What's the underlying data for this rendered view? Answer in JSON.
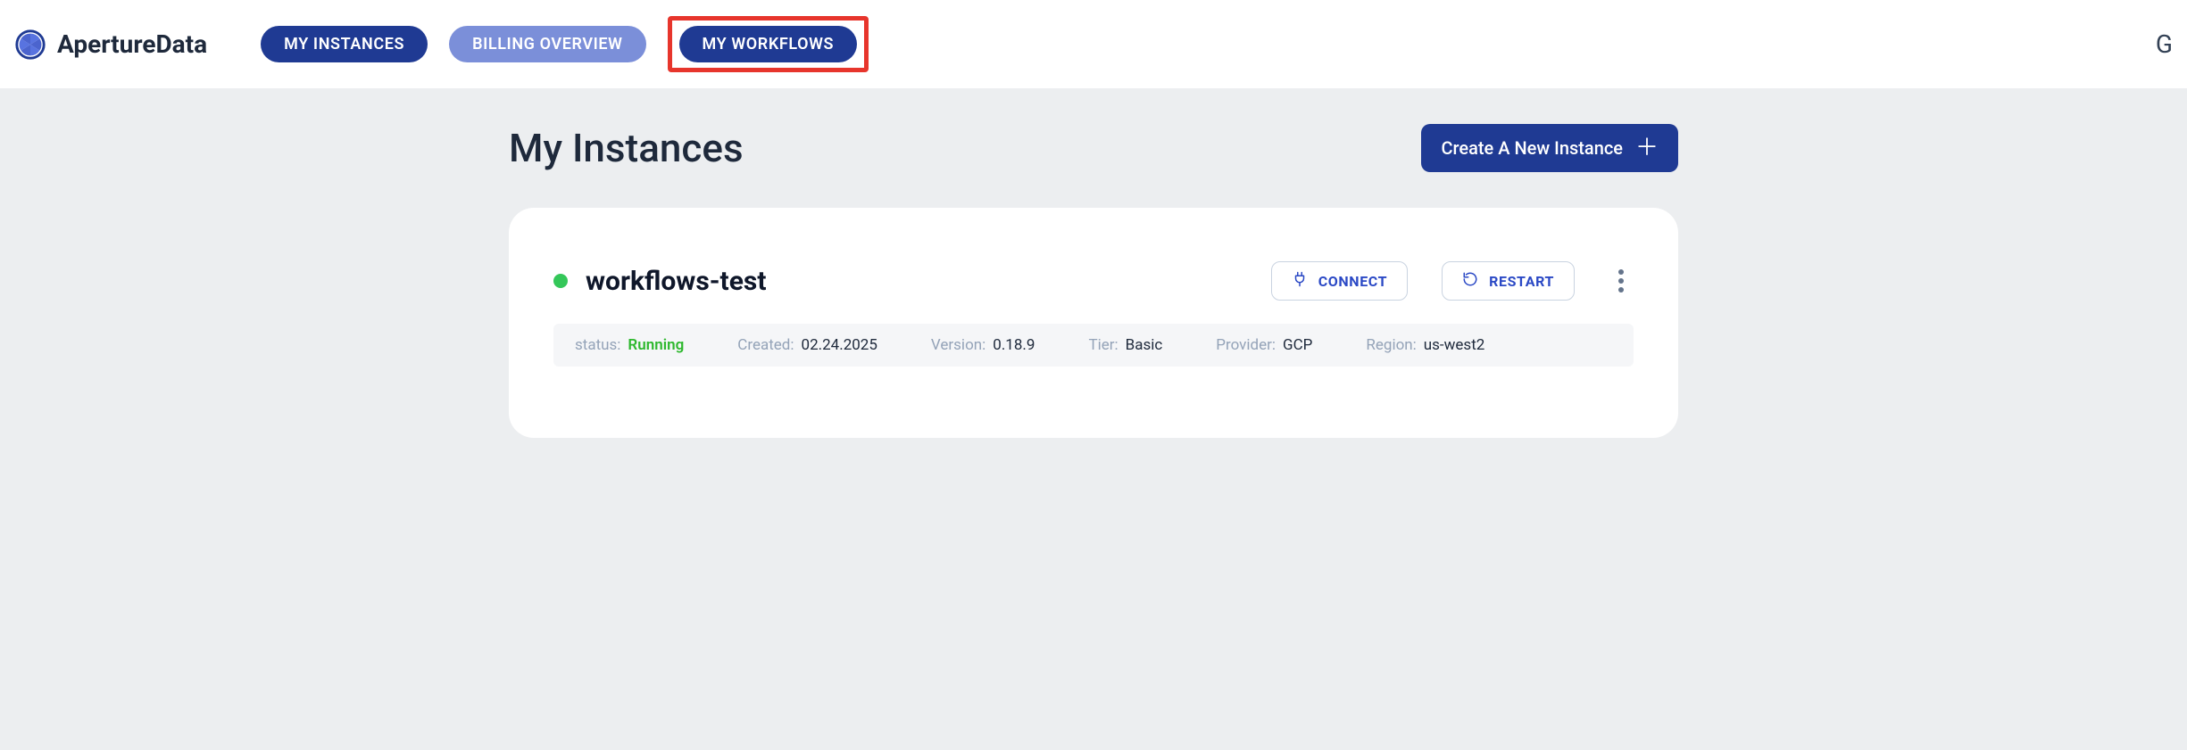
{
  "brand": {
    "name": "ApertureData"
  },
  "nav": {
    "my_instances": "MY INSTANCES",
    "billing_overview": "BILLING OVERVIEW",
    "my_workflows": "MY WORKFLOWS"
  },
  "header_right": {
    "glyph": "G"
  },
  "page": {
    "title": "My Instances",
    "create_label": "Create A New Instance"
  },
  "instance": {
    "name": "workflows-test",
    "status_color": "#34c759",
    "actions": {
      "connect": "CONNECT",
      "restart": "RESTART"
    },
    "details": {
      "status_label": "status:",
      "status_value": "Running",
      "created_label": "Created:",
      "created_value": "02.24.2025",
      "version_label": "Version:",
      "version_value": "0.18.9",
      "tier_label": "Tier:",
      "tier_value": "Basic",
      "provider_label": "Provider:",
      "provider_value": "GCP",
      "region_label": "Region:",
      "region_value": "us-west2"
    }
  }
}
